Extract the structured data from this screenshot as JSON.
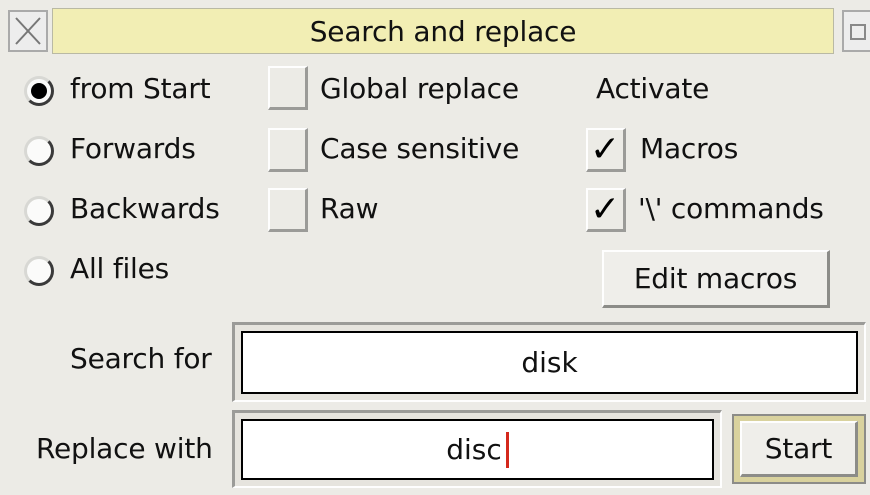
{
  "window": {
    "title": "Search and replace"
  },
  "direction": {
    "options": [
      {
        "label": "from Start",
        "selected": true
      },
      {
        "label": "Forwards",
        "selected": false
      },
      {
        "label": "Backwards",
        "selected": false
      },
      {
        "label": "All files",
        "selected": false
      }
    ]
  },
  "flags": {
    "global_replace": {
      "label": "Global replace",
      "checked": false
    },
    "case_sensitive": {
      "label": "Case sensitive",
      "checked": false
    },
    "raw": {
      "label": "Raw",
      "checked": false
    }
  },
  "activate": {
    "heading": "Activate",
    "macros": {
      "label": "Macros",
      "checked": true
    },
    "commands": {
      "label": "'\\' commands",
      "checked": true
    },
    "edit_button": "Edit macros"
  },
  "search": {
    "label": "Search for",
    "value": "disk"
  },
  "replace": {
    "label": "Replace with",
    "value": "disc"
  },
  "start_button": "Start",
  "icons": {
    "check": "✓"
  }
}
